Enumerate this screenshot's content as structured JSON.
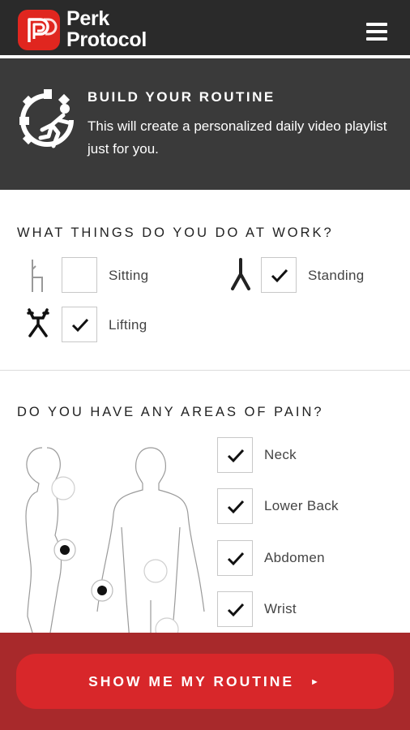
{
  "brand": {
    "name_line1": "Perk",
    "name_line2": "Protocol",
    "accent": "#e0261f"
  },
  "hero": {
    "title": "BUILD YOUR ROUTINE",
    "subtitle": "This will create a personalized daily video playlist just for you.",
    "icon": "gear-runner-icon"
  },
  "work": {
    "heading": "WHAT THINGS DO YOU DO AT WORK?",
    "options": [
      {
        "label": "Sitting",
        "checked": false,
        "icon": "sitting-icon"
      },
      {
        "label": "Standing",
        "checked": true,
        "icon": "standing-icon"
      },
      {
        "label": "Lifting",
        "checked": true,
        "icon": "lifting-icon"
      }
    ]
  },
  "pain": {
    "heading": "DO YOU HAVE ANY AREAS OF PAIN?",
    "options": [
      {
        "label": "Neck",
        "checked": true
      },
      {
        "label": "Lower Back",
        "checked": true
      },
      {
        "label": "Abdomen",
        "checked": true
      },
      {
        "label": "Wrist",
        "checked": true
      }
    ]
  },
  "cta": {
    "label": "SHOW ME MY ROUTINE",
    "icon": "play-arrow-icon"
  },
  "colors": {
    "header_bg": "#2a2a2a",
    "hero_bg": "#3a3a3a",
    "footer_bg": "#a8292b",
    "cta_bg": "#d8272a"
  }
}
